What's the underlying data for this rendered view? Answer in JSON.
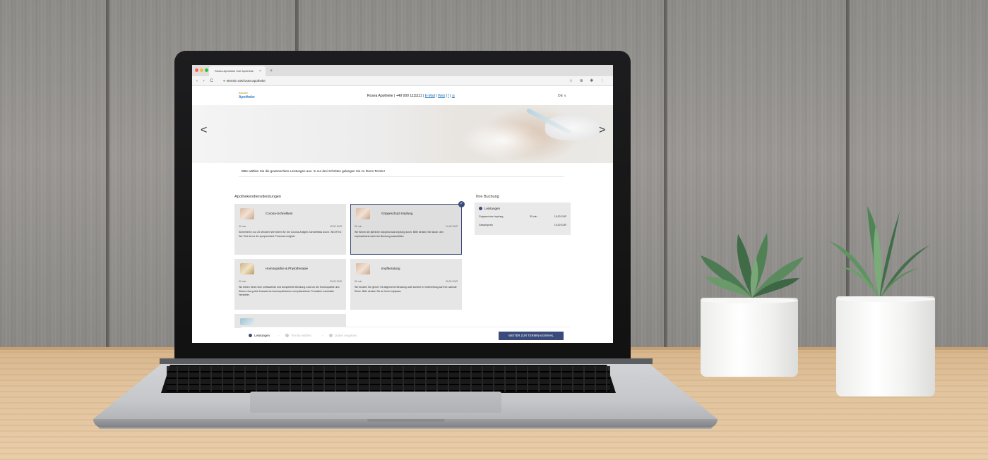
{
  "browser": {
    "tab_title": "Rosea Apotheke Ihre Apotheke",
    "tab_close": "×",
    "new_tab": "+",
    "url_host": "etermin.net",
    "url_path": "/rosea-apotheke",
    "nav_icons": "‹ › C",
    "tool_icons": "☆ ⊕ ✱ ⋮"
  },
  "site": {
    "logo_top": "Rosea®",
    "logo_bottom": "Apotheke",
    "pharmacy_name": "Rosea Apotheke",
    "phone": "+49 000 1111111",
    "email_link": "E-Mail",
    "web_link": "Web",
    "language": "DE ∨",
    "separator": "|",
    "facebook_icon": "f",
    "instagram_icon": "◎"
  },
  "hero": {
    "prev_arrow": "<",
    "next_arrow": ">"
  },
  "intro_text": "Bitte wählen Sie die gewünschten Leistungen aus. In nur drei Schritten gelangen Sie zu Ihrem Termin!",
  "services": {
    "section_title": "Apothekendienstleistungen",
    "cards": [
      {
        "title": "Corona-Schnelltest",
        "duration": "30 min",
        "price": "15,00 EUR",
        "description": "Sicherheit in nur 20 Minuten! Wir führen für Sie Corona-Antigen-Schnelltests durch. WICHTIG: Der Test ist nur für symptomfreie Personen möglich."
      },
      {
        "title": "Grippeschutz-Impfung",
        "duration": "30 min",
        "price": "10,00 EUR",
        "description": "Wir führen die jährliche Grippeschutz-Impfung durch. Bitte denken Sie daran, den Impfnachweis nach der Buchung auszufüllen."
      },
      {
        "title": "Homöopathie & Phytotherapie",
        "duration": "30 min",
        "price": "20,00 EUR",
        "description": "Wir bieten Ihnen eine umfassende und kompetente Beratung rund um die Homöopathie und führen eine große Auswahl an homöopathischen und pflanzlichen Produkten namhafter Hersteller."
      },
      {
        "title": "Impfberatung",
        "duration": "30 min",
        "price": "30,00 EUR",
        "description": "Wir beraten Sie gerne! Ob allgemeine Beratung oder konkret in Vorbereitung auf Ihre nächste Reise. Bitte denken Sie an Ihren Impfpass."
      }
    ],
    "selected_mark": "✓"
  },
  "booking": {
    "title": "Ihre Buchung",
    "section_label": "Leistungen",
    "item_name": "Grippeschutz-Impfung",
    "item_duration": "30 min",
    "item_price": "10,00 EUR",
    "total_label": "Gesamtpreis",
    "total_price": "10,00 EUR"
  },
  "footer": {
    "steps": [
      {
        "label": "Leistungen",
        "active": true
      },
      {
        "label": "Termin wählen",
        "active": false
      },
      {
        "label": "Daten eingeben",
        "active": false
      }
    ],
    "step_separator": "›",
    "next_button": "WEITER ZUR TERMINAUSWAHL"
  },
  "colors": {
    "primary": "#3a4a7a",
    "link": "#1a73c4",
    "card_bg": "#e6e6e6"
  }
}
